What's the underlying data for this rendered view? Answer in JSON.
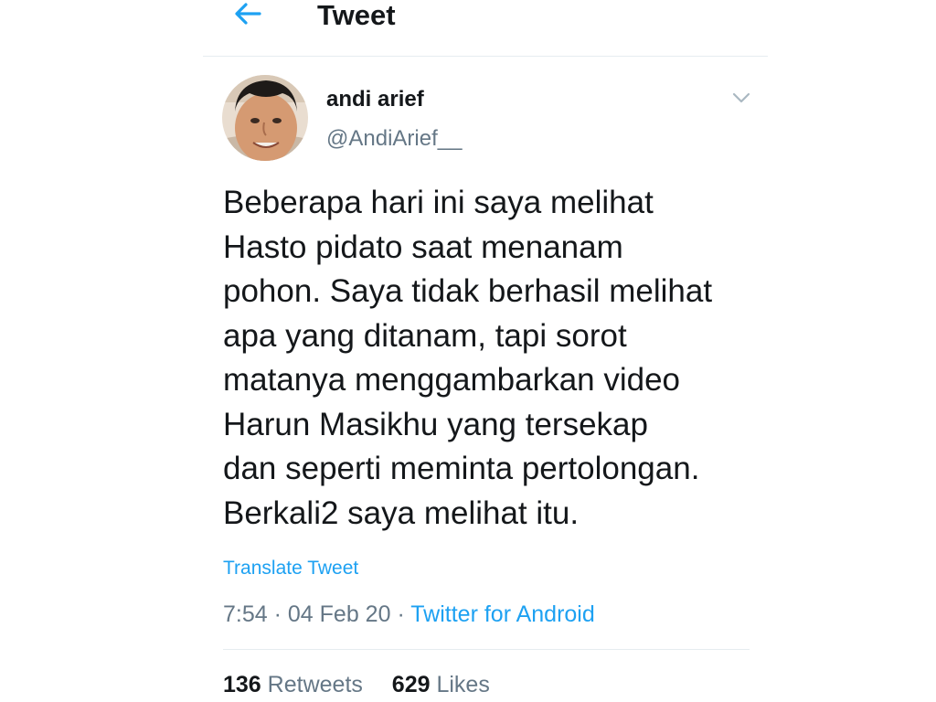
{
  "header": {
    "back_icon": "arrow-left-icon",
    "title": "Tweet"
  },
  "colors": {
    "accent": "#1da1f2",
    "text_primary": "#14171a",
    "text_secondary": "#657786",
    "divider": "#e6ecf0"
  },
  "tweet": {
    "author": {
      "display_name": "andi arief",
      "handle": "@AndiArief__",
      "avatar": "user-avatar-photo"
    },
    "menu_icon": "chevron-down-icon",
    "text_lines": [
      "Beberapa hari ini saya melihat",
      "Hasto pidato saat menanam",
      "pohon. Saya tidak berhasil melihat",
      "apa yang ditanam, tapi sorot",
      "matanya menggambarkan video",
      "Harun Masikhu yang tersekap",
      "dan seperti meminta pertolongan.",
      "Berkali2 saya melihat itu."
    ],
    "translate_label": "Translate Tweet",
    "time": "7:54",
    "separator": "·",
    "date": "04 Feb 20",
    "source": "Twitter for Android",
    "stats": {
      "retweets_count": "136",
      "retweets_label": "Retweets",
      "likes_count": "629",
      "likes_label": "Likes"
    }
  }
}
